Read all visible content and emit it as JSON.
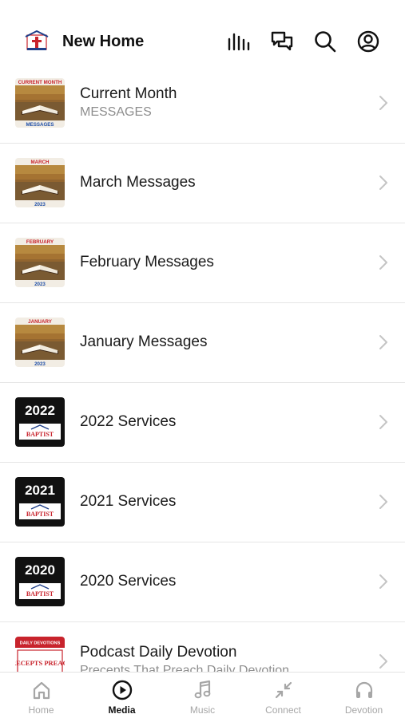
{
  "header": {
    "title": "New Home",
    "logo_icon": "church-logo-icon",
    "icons": [
      "equalizer-icon",
      "chat-icon",
      "search-icon",
      "account-icon"
    ]
  },
  "items": [
    {
      "title": "Current Month",
      "subtitle": "MESSAGES",
      "thumb_top": "CURRENT MONTH",
      "thumb_bottom": "MESSAGES",
      "thumb_style": "bible"
    },
    {
      "title": "March Messages",
      "subtitle": "",
      "thumb_top": "MARCH",
      "thumb_bottom": "2023",
      "thumb_style": "bible"
    },
    {
      "title": "February Messages",
      "subtitle": "",
      "thumb_top": "FEBRUARY",
      "thumb_bottom": "2023",
      "thumb_style": "bible"
    },
    {
      "title": "January Messages",
      "subtitle": "",
      "thumb_top": "JANUARY",
      "thumb_bottom": "2023",
      "thumb_style": "bible"
    },
    {
      "title": "2022 Services",
      "subtitle": "",
      "thumb_top": "2022",
      "thumb_bottom": "BAPTIST",
      "thumb_style": "year"
    },
    {
      "title": "2021 Services",
      "subtitle": "",
      "thumb_top": "2021",
      "thumb_bottom": "BAPTIST",
      "thumb_style": "year"
    },
    {
      "title": "2020 Services",
      "subtitle": "",
      "thumb_top": "2020",
      "thumb_bottom": "BAPTIST",
      "thumb_style": "year"
    },
    {
      "title": "Podcast Daily Devotion",
      "subtitle": "Precepts That Preach Daily Devotion",
      "thumb_top": "DAILY DEVOTIONS",
      "thumb_bottom": "PRECEPTS PREACH",
      "thumb_style": "podcast"
    }
  ],
  "tabs": [
    {
      "label": "Home",
      "icon": "home-icon",
      "active": false
    },
    {
      "label": "Media",
      "icon": "play-circle-icon",
      "active": true
    },
    {
      "label": "Music",
      "icon": "music-note-icon",
      "active": false
    },
    {
      "label": "Connect",
      "icon": "connect-arrows-icon",
      "active": false
    },
    {
      "label": "Devotion",
      "icon": "headphones-icon",
      "active": false
    }
  ],
  "colors": {
    "active_tab": "#111111",
    "inactive_tab": "#a6a6a6",
    "thumb_red": "#c8232c",
    "thumb_blue": "#1f4fa8"
  }
}
